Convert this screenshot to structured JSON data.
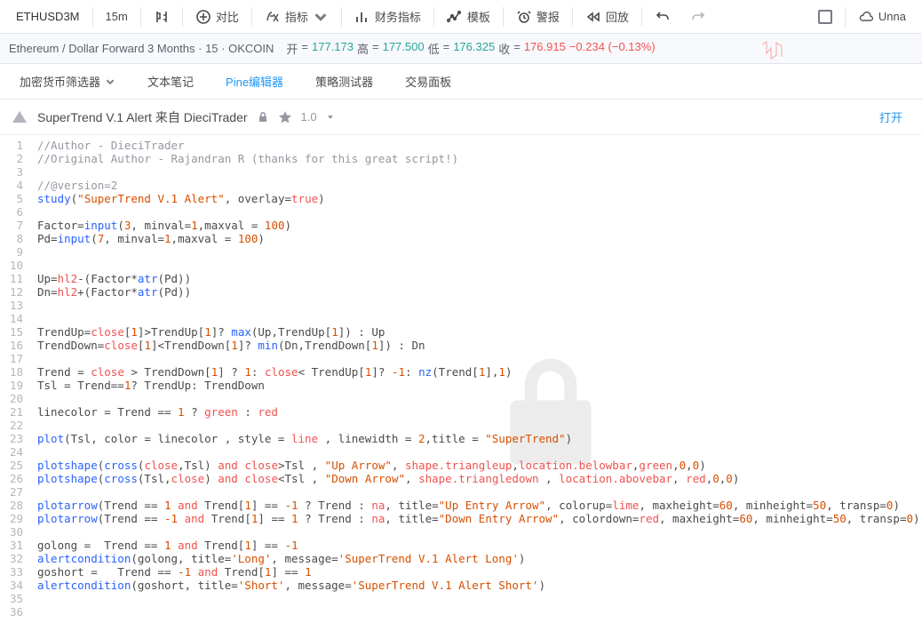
{
  "toolbar": {
    "symbol": "ETHUSD3M",
    "interval": "15m",
    "compare": "对比",
    "indicators": "指标",
    "financials": "财务指标",
    "templates": "模板",
    "alerts": "警报",
    "replay": "回放",
    "unnamed": "Unna"
  },
  "status": {
    "title": "Ethereum / Dollar Forward 3 Months · 15 · OKCOIN",
    "open_label": "开",
    "open": "177.173",
    "high_label": "高",
    "high": "177.500",
    "low_label": "低",
    "low": "176.325",
    "close_label": "收",
    "close": "176.915",
    "change": "−0.234 (−0.13%)"
  },
  "tabs": {
    "screener": "加密货币筛选器",
    "notes": "文本笔记",
    "pine": "Pine编辑器",
    "tester": "策略测试器",
    "panel": "交易面板"
  },
  "script": {
    "title": "SuperTrend V.1 Alert 来自 DieciTrader",
    "version": "1.0",
    "open": "打开"
  },
  "code": {
    "lines": [
      [
        [
          "comment",
          "//Author - DieciTrader"
        ]
      ],
      [
        [
          "comment",
          "//Original Author - Rajandran R (thanks for this great script!)"
        ]
      ],
      [],
      [
        [
          "comment",
          "//@version=2"
        ]
      ],
      [
        [
          "fn",
          "study"
        ],
        [
          "p",
          "("
        ],
        [
          "str",
          "\"SuperTrend V.1 Alert\""
        ],
        [
          "p",
          ", overlay="
        ],
        [
          "const",
          "true"
        ],
        [
          "p",
          ")"
        ]
      ],
      [],
      [
        [
          "p",
          "Factor="
        ],
        [
          "fn",
          "input"
        ],
        [
          "p",
          "("
        ],
        [
          "num",
          "3"
        ],
        [
          "p",
          ", minval="
        ],
        [
          "num",
          "1"
        ],
        [
          "p",
          ",maxval = "
        ],
        [
          "num",
          "100"
        ],
        [
          "p",
          ")"
        ]
      ],
      [
        [
          "p",
          "Pd="
        ],
        [
          "fn",
          "input"
        ],
        [
          "p",
          "("
        ],
        [
          "num",
          "7"
        ],
        [
          "p",
          ", minval="
        ],
        [
          "num",
          "1"
        ],
        [
          "p",
          ",maxval = "
        ],
        [
          "num",
          "100"
        ],
        [
          "p",
          ")"
        ]
      ],
      [],
      [],
      [
        [
          "p",
          "Up="
        ],
        [
          "const",
          "hl2"
        ],
        [
          "p",
          "-(Factor*"
        ],
        [
          "fn",
          "atr"
        ],
        [
          "p",
          "(Pd))"
        ]
      ],
      [
        [
          "p",
          "Dn="
        ],
        [
          "const",
          "hl2"
        ],
        [
          "p",
          "+(Factor*"
        ],
        [
          "fn",
          "atr"
        ],
        [
          "p",
          "(Pd))"
        ]
      ],
      [],
      [],
      [
        [
          "p",
          "TrendUp="
        ],
        [
          "const",
          "close"
        ],
        [
          "p",
          "["
        ],
        [
          "num",
          "1"
        ],
        [
          "p",
          "]>TrendUp["
        ],
        [
          "num",
          "1"
        ],
        [
          "p",
          "]? "
        ],
        [
          "fn",
          "max"
        ],
        [
          "p",
          "(Up,TrendUp["
        ],
        [
          "num",
          "1"
        ],
        [
          "p",
          "]) : Up"
        ]
      ],
      [
        [
          "p",
          "TrendDown="
        ],
        [
          "const",
          "close"
        ],
        [
          "p",
          "["
        ],
        [
          "num",
          "1"
        ],
        [
          "p",
          "]<TrendDown["
        ],
        [
          "num",
          "1"
        ],
        [
          "p",
          "]? "
        ],
        [
          "fn",
          "min"
        ],
        [
          "p",
          "(Dn,TrendDown["
        ],
        [
          "num",
          "1"
        ],
        [
          "p",
          "]) : Dn"
        ]
      ],
      [],
      [
        [
          "p",
          "Trend = "
        ],
        [
          "const",
          "close"
        ],
        [
          "p",
          " > TrendDown["
        ],
        [
          "num",
          "1"
        ],
        [
          "p",
          "] ? "
        ],
        [
          "num",
          "1"
        ],
        [
          "p",
          ": "
        ],
        [
          "const",
          "close"
        ],
        [
          "p",
          "< TrendUp["
        ],
        [
          "num",
          "1"
        ],
        [
          "p",
          "]? "
        ],
        [
          "num",
          "-1"
        ],
        [
          "p",
          ": "
        ],
        [
          "fn",
          "nz"
        ],
        [
          "p",
          "(Trend["
        ],
        [
          "num",
          "1"
        ],
        [
          "p",
          "],"
        ],
        [
          "num",
          "1"
        ],
        [
          "p",
          ")"
        ]
      ],
      [
        [
          "p",
          "Tsl = Trend=="
        ],
        [
          "num",
          "1"
        ],
        [
          "p",
          "? TrendUp: TrendDown"
        ]
      ],
      [],
      [
        [
          "p",
          "linecolor = Trend == "
        ],
        [
          "num",
          "1"
        ],
        [
          "p",
          " ? "
        ],
        [
          "const",
          "green"
        ],
        [
          "p",
          " : "
        ],
        [
          "const",
          "red"
        ]
      ],
      [],
      [
        [
          "fn",
          "plot"
        ],
        [
          "p",
          "(Tsl, color = linecolor , style = "
        ],
        [
          "const",
          "line"
        ],
        [
          "p",
          " , linewidth = "
        ],
        [
          "num",
          "2"
        ],
        [
          "p",
          ",title = "
        ],
        [
          "str",
          "\"SuperTrend\""
        ],
        [
          "p",
          ")"
        ]
      ],
      [],
      [
        [
          "fn",
          "plotshape"
        ],
        [
          "p",
          "("
        ],
        [
          "fn",
          "cross"
        ],
        [
          "p",
          "("
        ],
        [
          "const",
          "close"
        ],
        [
          "p",
          ",Tsl) "
        ],
        [
          "op",
          "and"
        ],
        [
          "p",
          " "
        ],
        [
          "const",
          "close"
        ],
        [
          "p",
          ">Tsl , "
        ],
        [
          "str",
          "\"Up Arrow\""
        ],
        [
          "p",
          ", "
        ],
        [
          "const",
          "shape.triangleup"
        ],
        [
          "p",
          ","
        ],
        [
          "const",
          "location.belowbar"
        ],
        [
          "p",
          ","
        ],
        [
          "const",
          "green"
        ],
        [
          "p",
          ","
        ],
        [
          "num",
          "0"
        ],
        [
          "p",
          ","
        ],
        [
          "num",
          "0"
        ],
        [
          "p",
          ")"
        ]
      ],
      [
        [
          "fn",
          "plotshape"
        ],
        [
          "p",
          "("
        ],
        [
          "fn",
          "cross"
        ],
        [
          "p",
          "(Tsl,"
        ],
        [
          "const",
          "close"
        ],
        [
          "p",
          ") "
        ],
        [
          "op",
          "and"
        ],
        [
          "p",
          " "
        ],
        [
          "const",
          "close"
        ],
        [
          "p",
          "<Tsl , "
        ],
        [
          "str",
          "\"Down Arrow\""
        ],
        [
          "p",
          ", "
        ],
        [
          "const",
          "shape.triangledown"
        ],
        [
          "p",
          " , "
        ],
        [
          "const",
          "location.abovebar"
        ],
        [
          "p",
          ", "
        ],
        [
          "const",
          "red"
        ],
        [
          "p",
          ","
        ],
        [
          "num",
          "0"
        ],
        [
          "p",
          ","
        ],
        [
          "num",
          "0"
        ],
        [
          "p",
          ")"
        ]
      ],
      [],
      [
        [
          "fn",
          "plotarrow"
        ],
        [
          "p",
          "(Trend == "
        ],
        [
          "num",
          "1"
        ],
        [
          "p",
          " "
        ],
        [
          "op",
          "and"
        ],
        [
          "p",
          " Trend["
        ],
        [
          "num",
          "1"
        ],
        [
          "p",
          "] == "
        ],
        [
          "num",
          "-1"
        ],
        [
          "p",
          " ? Trend : "
        ],
        [
          "const",
          "na"
        ],
        [
          "p",
          ", title="
        ],
        [
          "str",
          "\"Up Entry Arrow\""
        ],
        [
          "p",
          ", colorup="
        ],
        [
          "const",
          "lime"
        ],
        [
          "p",
          ", maxheight="
        ],
        [
          "num",
          "60"
        ],
        [
          "p",
          ", minheight="
        ],
        [
          "num",
          "50"
        ],
        [
          "p",
          ", transp="
        ],
        [
          "num",
          "0"
        ],
        [
          "p",
          ")"
        ]
      ],
      [
        [
          "fn",
          "plotarrow"
        ],
        [
          "p",
          "(Trend == "
        ],
        [
          "num",
          "-1"
        ],
        [
          "p",
          " "
        ],
        [
          "op",
          "and"
        ],
        [
          "p",
          " Trend["
        ],
        [
          "num",
          "1"
        ],
        [
          "p",
          "] == "
        ],
        [
          "num",
          "1"
        ],
        [
          "p",
          " ? Trend : "
        ],
        [
          "const",
          "na"
        ],
        [
          "p",
          ", title="
        ],
        [
          "str",
          "\"Down Entry Arrow\""
        ],
        [
          "p",
          ", colordown="
        ],
        [
          "const",
          "red"
        ],
        [
          "p",
          ", maxheight="
        ],
        [
          "num",
          "60"
        ],
        [
          "p",
          ", minheight="
        ],
        [
          "num",
          "50"
        ],
        [
          "p",
          ", transp="
        ],
        [
          "num",
          "0"
        ],
        [
          "p",
          ")"
        ]
      ],
      [],
      [
        [
          "p",
          "golong =  Trend == "
        ],
        [
          "num",
          "1"
        ],
        [
          "p",
          " "
        ],
        [
          "op",
          "and"
        ],
        [
          "p",
          " Trend["
        ],
        [
          "num",
          "1"
        ],
        [
          "p",
          "] == "
        ],
        [
          "num",
          "-1"
        ]
      ],
      [
        [
          "fn",
          "alertcondition"
        ],
        [
          "p",
          "(golong, title="
        ],
        [
          "str",
          "'Long'"
        ],
        [
          "p",
          ", message="
        ],
        [
          "str",
          "'SuperTrend V.1 Alert Long'"
        ],
        [
          "p",
          ")"
        ]
      ],
      [
        [
          "p",
          "goshort =   Trend == "
        ],
        [
          "num",
          "-1"
        ],
        [
          "p",
          " "
        ],
        [
          "op",
          "and"
        ],
        [
          "p",
          " Trend["
        ],
        [
          "num",
          "1"
        ],
        [
          "p",
          "] == "
        ],
        [
          "num",
          "1"
        ]
      ],
      [
        [
          "fn",
          "alertcondition"
        ],
        [
          "p",
          "(goshort, title="
        ],
        [
          "str",
          "'Short'"
        ],
        [
          "p",
          ", message="
        ],
        [
          "str",
          "'SuperTrend V.1 Alert Short'"
        ],
        [
          "p",
          ")"
        ]
      ],
      [],
      []
    ]
  }
}
